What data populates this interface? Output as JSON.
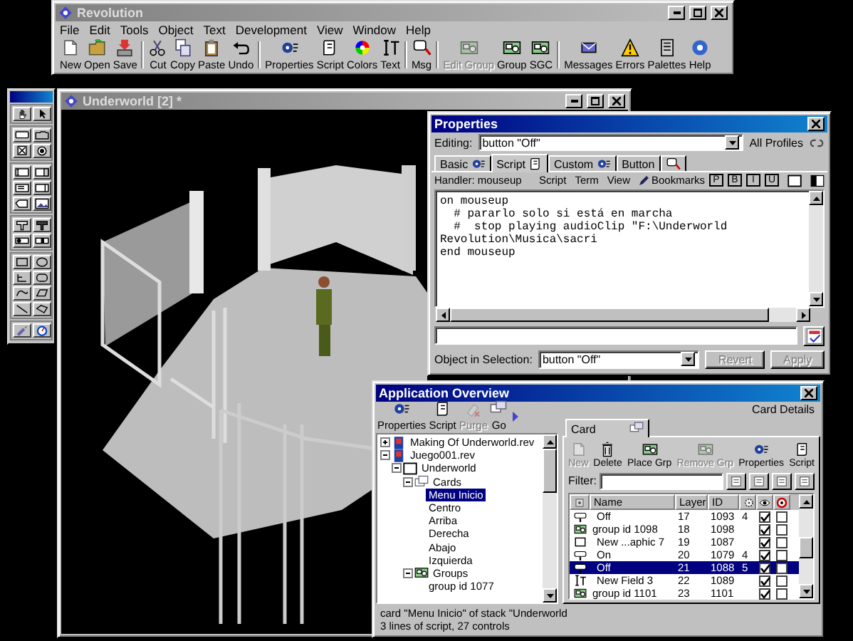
{
  "main_window": {
    "title": "Revolution",
    "active": false,
    "menu": [
      "File",
      "Edit",
      "Tools",
      "Object",
      "Text",
      "Development",
      "View",
      "Window",
      "Help"
    ],
    "toolbar": [
      {
        "label": "New",
        "disabled": false
      },
      {
        "label": "Open",
        "disabled": false
      },
      {
        "label": "Save",
        "disabled": false
      },
      {
        "label": "Cut",
        "disabled": false
      },
      {
        "label": "Copy",
        "disabled": false
      },
      {
        "label": "Paste",
        "disabled": false
      },
      {
        "label": "Undo",
        "disabled": false
      },
      {
        "label": "Properties",
        "disabled": false
      },
      {
        "label": "Script",
        "disabled": false
      },
      {
        "label": "Colors",
        "disabled": false
      },
      {
        "label": "Text",
        "disabled": false
      },
      {
        "label": "Msg",
        "disabled": false
      },
      {
        "label": "Edit Group",
        "disabled": true
      },
      {
        "label": "Group",
        "disabled": false
      },
      {
        "label": "SGC",
        "disabled": false
      },
      {
        "label": "Messages",
        "disabled": false
      },
      {
        "label": "Errors",
        "disabled": false
      },
      {
        "label": "Palettes",
        "disabled": false
      },
      {
        "label": "Help",
        "disabled": false
      }
    ]
  },
  "stage_window": {
    "title": "Underworld [2] *",
    "active": false
  },
  "properties_window": {
    "title": "Properties",
    "active": true,
    "editing_label": "Editing:",
    "editing_value": "button \"Off\"",
    "profiles": "All Profiles",
    "tabs": [
      {
        "label": "Basic",
        "selected": false
      },
      {
        "label": "Script",
        "selected": true
      },
      {
        "label": "Custom",
        "selected": false
      },
      {
        "label": "Button",
        "selected": false
      }
    ],
    "handler": "Handler: mouseup",
    "script_menu": [
      "Script",
      "Term",
      "View",
      "Bookmarks"
    ],
    "format_buttons": [
      "P",
      "B",
      "I",
      "U"
    ],
    "script": [
      "on mouseup",
      "  # pararlo solo si está en marcha",
      "  #  stop playing audioClip \"F:\\Underworld Revolution\\Musica\\sacri",
      "end mouseup"
    ],
    "selection_label": "Object in Selection:",
    "selection_value": "button \"Off\"",
    "buttons": [
      {
        "label": "Revert",
        "disabled": true
      },
      {
        "label": "Apply",
        "disabled": true
      }
    ]
  },
  "overview_window": {
    "title": "Application Overview",
    "active": true,
    "toolbar": [
      {
        "label": "Properties",
        "disabled": false
      },
      {
        "label": "Script",
        "disabled": false
      },
      {
        "label": "Purge",
        "disabled": true
      },
      {
        "label": "Go",
        "disabled": false
      }
    ],
    "details_label": "Card Details",
    "tree": [
      {
        "label": "Making Of Underworld.rev",
        "kind": "stack",
        "expanded": false,
        "selected": false
      },
      {
        "label": "Juego001.rev",
        "kind": "stack",
        "expanded": true,
        "selected": false,
        "children": [
          {
            "label": "Underworld",
            "kind": "window",
            "expanded": true,
            "selected": false,
            "children": [
              {
                "label": "Cards",
                "kind": "folder",
                "expanded": true,
                "selected": false,
                "children": [
                  {
                    "label": "Menu Inicio",
                    "selected": true
                  },
                  {
                    "label": "Centro",
                    "selected": false
                  },
                  {
                    "label": "Arriba",
                    "selected": false
                  },
                  {
                    "label": "Derecha",
                    "selected": false
                  },
                  {
                    "label": "Abajo",
                    "selected": false
                  },
                  {
                    "label": "Izquierda",
                    "selected": false
                  }
                ]
              },
              {
                "label": "Groups",
                "kind": "group",
                "expanded": true,
                "selected": false,
                "children": [
                  {
                    "label": "group id 1077",
                    "selected": false
                  }
                ]
              }
            ]
          }
        ]
      }
    ],
    "tabs": [
      {
        "label": "Card",
        "selected": true
      }
    ],
    "card_toolbar": [
      {
        "label": "New",
        "disabled": true
      },
      {
        "label": "Delete",
        "disabled": false
      },
      {
        "label": "Place Grp",
        "disabled": false
      },
      {
        "label": "Remove Grp",
        "disabled": true
      },
      {
        "label": "Properties",
        "disabled": false
      },
      {
        "label": "Script",
        "disabled": false
      }
    ],
    "filter_label": "Filter:",
    "columns": [
      "Name",
      "Layer",
      "ID"
    ],
    "rows": [
      {
        "kind": "button",
        "name": "Off",
        "layer": "17",
        "id": "1093",
        "column_4": "4",
        "visible": true,
        "column_7": false,
        "selected": false
      },
      {
        "kind": "group",
        "name": "group id 1098",
        "layer": "18",
        "id": "1098",
        "visible": true,
        "column_7": false,
        "selected": false
      },
      {
        "kind": "graphic",
        "name": "New ...aphic 7",
        "layer": "19",
        "id": "1087",
        "visible": true,
        "column_7": false,
        "selected": false
      },
      {
        "kind": "button",
        "name": "On",
        "layer": "20",
        "id": "1079",
        "column_4": "4",
        "visible": true,
        "column_7": false,
        "selected": false
      },
      {
        "kind": "button",
        "name": "Off",
        "layer": "21",
        "id": "1088",
        "column_4": "5",
        "visible": true,
        "column_7": false,
        "selected": true
      },
      {
        "kind": "field",
        "name": "New Field 3",
        "layer": "22",
        "id": "1089",
        "visible": true,
        "column_7": false,
        "selected": false
      },
      {
        "kind": "group",
        "name": "group id 1101",
        "layer": "23",
        "id": "1101",
        "visible": true,
        "column_7": false,
        "selected": false
      }
    ],
    "status": [
      "card \"Menu Inicio\" of stack \"Underworld",
      "3 lines of script, 27 controls"
    ]
  }
}
